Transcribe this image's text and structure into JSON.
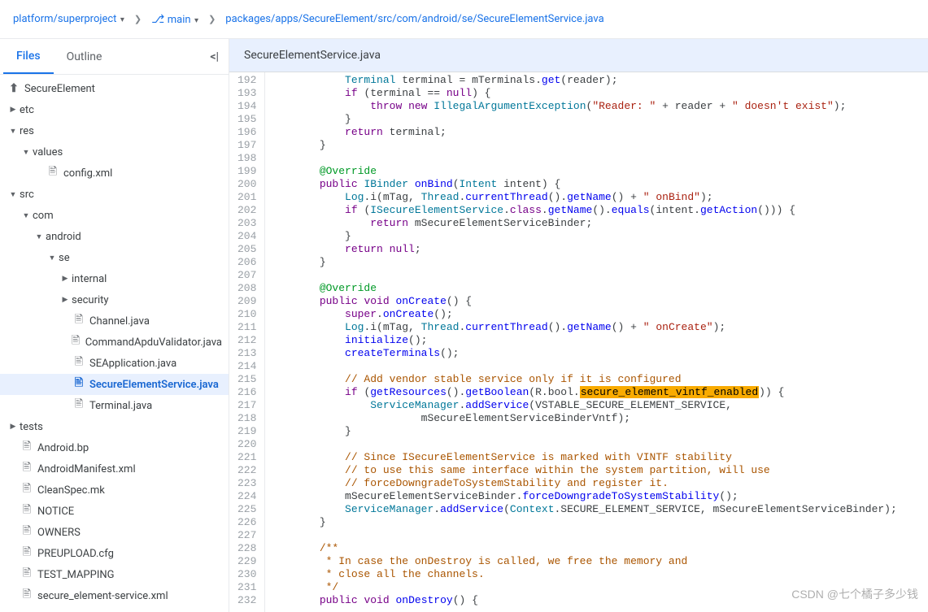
{
  "breadcrumb": {
    "project": "platform/superproject",
    "branch": "main",
    "path": "packages/apps/SecureElement/src/com/android/se/SecureElementService.java"
  },
  "tabs": {
    "files": "Files",
    "outline": "Outline"
  },
  "tree": {
    "root": "SecureElement",
    "etc": "etc",
    "res": "res",
    "values": "values",
    "config": "config.xml",
    "src": "src",
    "com": "com",
    "android": "android",
    "se": "se",
    "internal": "internal",
    "security": "security",
    "channel": "Channel.java",
    "apdu": "CommandApduValidator.java",
    "seapp": "SEApplication.java",
    "sesvc": "SecureElementService.java",
    "terminal": "Terminal.java",
    "tests": "tests",
    "androidbp": "Android.bp",
    "manifest": "AndroidManifest.xml",
    "cleanspec": "CleanSpec.mk",
    "notice": "NOTICE",
    "owners": "OWNERS",
    "preupload": "PREUPLOAD.cfg",
    "testmapping": "TEST_MAPPING",
    "sexml": "secure_element-service.xml"
  },
  "file_title": "SecureElementService.java",
  "line_start": 192,
  "line_end": 232,
  "code": [
    [
      [
        "",
        "            "
      ],
      [
        "type",
        "Terminal"
      ],
      [
        "",
        " terminal = mTerminals."
      ],
      [
        "fn",
        "get"
      ],
      [
        "",
        "(reader);"
      ]
    ],
    [
      [
        "",
        "            "
      ],
      [
        "kw",
        "if"
      ],
      [
        "",
        " (terminal == "
      ],
      [
        "kw",
        "null"
      ],
      [
        "",
        ") {"
      ]
    ],
    [
      [
        "",
        "                "
      ],
      [
        "kw",
        "throw"
      ],
      [
        "",
        " "
      ],
      [
        "kw",
        "new"
      ],
      [
        "",
        " "
      ],
      [
        "type",
        "IllegalArgumentException"
      ],
      [
        "",
        "("
      ],
      [
        "str",
        "\"Reader: \""
      ],
      [
        "",
        " + reader + "
      ],
      [
        "str",
        "\" doesn't exist\""
      ],
      [
        "",
        ");"
      ]
    ],
    [
      [
        "",
        "            }"
      ]
    ],
    [
      [
        "",
        "            "
      ],
      [
        "kw",
        "return"
      ],
      [
        "",
        " terminal;"
      ]
    ],
    [
      [
        "",
        "        }"
      ]
    ],
    [
      [
        "",
        ""
      ]
    ],
    [
      [
        "",
        "        "
      ],
      [
        "ann",
        "@Override"
      ]
    ],
    [
      [
        "",
        "        "
      ],
      [
        "kw",
        "public"
      ],
      [
        "",
        " "
      ],
      [
        "type",
        "IBinder"
      ],
      [
        "",
        " "
      ],
      [
        "fn",
        "onBind"
      ],
      [
        "",
        "("
      ],
      [
        "type",
        "Intent"
      ],
      [
        "",
        " intent) {"
      ]
    ],
    [
      [
        "",
        "            "
      ],
      [
        "type",
        "Log"
      ],
      [
        "",
        ".i(mTag, "
      ],
      [
        "type",
        "Thread"
      ],
      [
        "",
        "."
      ],
      [
        "fn",
        "currentThread"
      ],
      [
        "",
        "()."
      ],
      [
        "fn",
        "getName"
      ],
      [
        "",
        "() + "
      ],
      [
        "str",
        "\" onBind\""
      ],
      [
        "",
        ");"
      ]
    ],
    [
      [
        "",
        "            "
      ],
      [
        "kw",
        "if"
      ],
      [
        "",
        " ("
      ],
      [
        "type",
        "ISecureElementService"
      ],
      [
        "",
        "."
      ],
      [
        "kw",
        "class"
      ],
      [
        "",
        "."
      ],
      [
        "fn",
        "getName"
      ],
      [
        "",
        "()."
      ],
      [
        "fn",
        "equals"
      ],
      [
        "",
        "(intent."
      ],
      [
        "fn",
        "getAction"
      ],
      [
        "",
        "())) {"
      ]
    ],
    [
      [
        "",
        "                "
      ],
      [
        "kw",
        "return"
      ],
      [
        "",
        " mSecureElementServiceBinder;"
      ]
    ],
    [
      [
        "",
        "            }"
      ]
    ],
    [
      [
        "",
        "            "
      ],
      [
        "kw",
        "return"
      ],
      [
        "",
        " "
      ],
      [
        "kw",
        "null"
      ],
      [
        "",
        ";"
      ]
    ],
    [
      [
        "",
        "        }"
      ]
    ],
    [
      [
        "",
        ""
      ]
    ],
    [
      [
        "",
        "        "
      ],
      [
        "ann",
        "@Override"
      ]
    ],
    [
      [
        "",
        "        "
      ],
      [
        "kw",
        "public"
      ],
      [
        "",
        " "
      ],
      [
        "kw",
        "void"
      ],
      [
        "",
        " "
      ],
      [
        "fn",
        "onCreate"
      ],
      [
        "",
        "() {"
      ]
    ],
    [
      [
        "",
        "            "
      ],
      [
        "kw",
        "super"
      ],
      [
        "",
        "."
      ],
      [
        "fn",
        "onCreate"
      ],
      [
        "",
        "();"
      ]
    ],
    [
      [
        "",
        "            "
      ],
      [
        "type",
        "Log"
      ],
      [
        "",
        ".i(mTag, "
      ],
      [
        "type",
        "Thread"
      ],
      [
        "",
        "."
      ],
      [
        "fn",
        "currentThread"
      ],
      [
        "",
        "()."
      ],
      [
        "fn",
        "getName"
      ],
      [
        "",
        "() + "
      ],
      [
        "str",
        "\" onCreate\""
      ],
      [
        "",
        ");"
      ]
    ],
    [
      [
        "",
        "            "
      ],
      [
        "fn",
        "initialize"
      ],
      [
        "",
        "();"
      ]
    ],
    [
      [
        "",
        "            "
      ],
      [
        "fn",
        "createTerminals"
      ],
      [
        "",
        "();"
      ]
    ],
    [
      [
        "",
        ""
      ]
    ],
    [
      [
        "",
        "            "
      ],
      [
        "com",
        "// Add vendor stable service only if it is configured"
      ]
    ],
    [
      [
        "",
        "            "
      ],
      [
        "kw",
        "if"
      ],
      [
        "",
        " ("
      ],
      [
        "fn",
        "getResources"
      ],
      [
        "",
        "()."
      ],
      [
        "fn",
        "getBoolean"
      ],
      [
        "",
        "(R.bool."
      ],
      [
        "hl",
        "secure_element_vintf_enabled"
      ],
      [
        "",
        ")) {"
      ]
    ],
    [
      [
        "",
        "                "
      ],
      [
        "type",
        "ServiceManager"
      ],
      [
        "",
        "."
      ],
      [
        "fn",
        "addService"
      ],
      [
        "",
        "(VSTABLE_SECURE_ELEMENT_SERVICE,"
      ]
    ],
    [
      [
        "",
        "                        mSecureElementServiceBinderVntf);"
      ]
    ],
    [
      [
        "",
        "            }"
      ]
    ],
    [
      [
        "",
        ""
      ]
    ],
    [
      [
        "",
        "            "
      ],
      [
        "com",
        "// Since ISecureElementService is marked with VINTF stability"
      ]
    ],
    [
      [
        "",
        "            "
      ],
      [
        "com",
        "// to use this same interface within the system partition, will use"
      ]
    ],
    [
      [
        "",
        "            "
      ],
      [
        "com",
        "// forceDowngradeToSystemStability and register it."
      ]
    ],
    [
      [
        "",
        "            mSecureElementServiceBinder."
      ],
      [
        "fn",
        "forceDowngradeToSystemStability"
      ],
      [
        "",
        "();"
      ]
    ],
    [
      [
        "",
        "            "
      ],
      [
        "type",
        "ServiceManager"
      ],
      [
        "",
        "."
      ],
      [
        "fn",
        "addService"
      ],
      [
        "",
        "("
      ],
      [
        "type",
        "Context"
      ],
      [
        "",
        ".SECURE_ELEMENT_SERVICE, mSecureElementServiceBinder);"
      ]
    ],
    [
      [
        "",
        "        }"
      ]
    ],
    [
      [
        "",
        ""
      ]
    ],
    [
      [
        "",
        "        "
      ],
      [
        "com",
        "/**"
      ]
    ],
    [
      [
        "",
        "         "
      ],
      [
        "com",
        "* In case the onDestroy is called, we free the memory and"
      ]
    ],
    [
      [
        "",
        "         "
      ],
      [
        "com",
        "* close all the channels."
      ]
    ],
    [
      [
        "",
        "         "
      ],
      [
        "com",
        "*/"
      ]
    ],
    [
      [
        "",
        "        "
      ],
      [
        "kw",
        "public"
      ],
      [
        "",
        " "
      ],
      [
        "kw",
        "void"
      ],
      [
        "",
        " "
      ],
      [
        "fn",
        "onDestroy"
      ],
      [
        "",
        "() {"
      ]
    ]
  ],
  "watermark": "CSDN @七个橘子多少钱"
}
